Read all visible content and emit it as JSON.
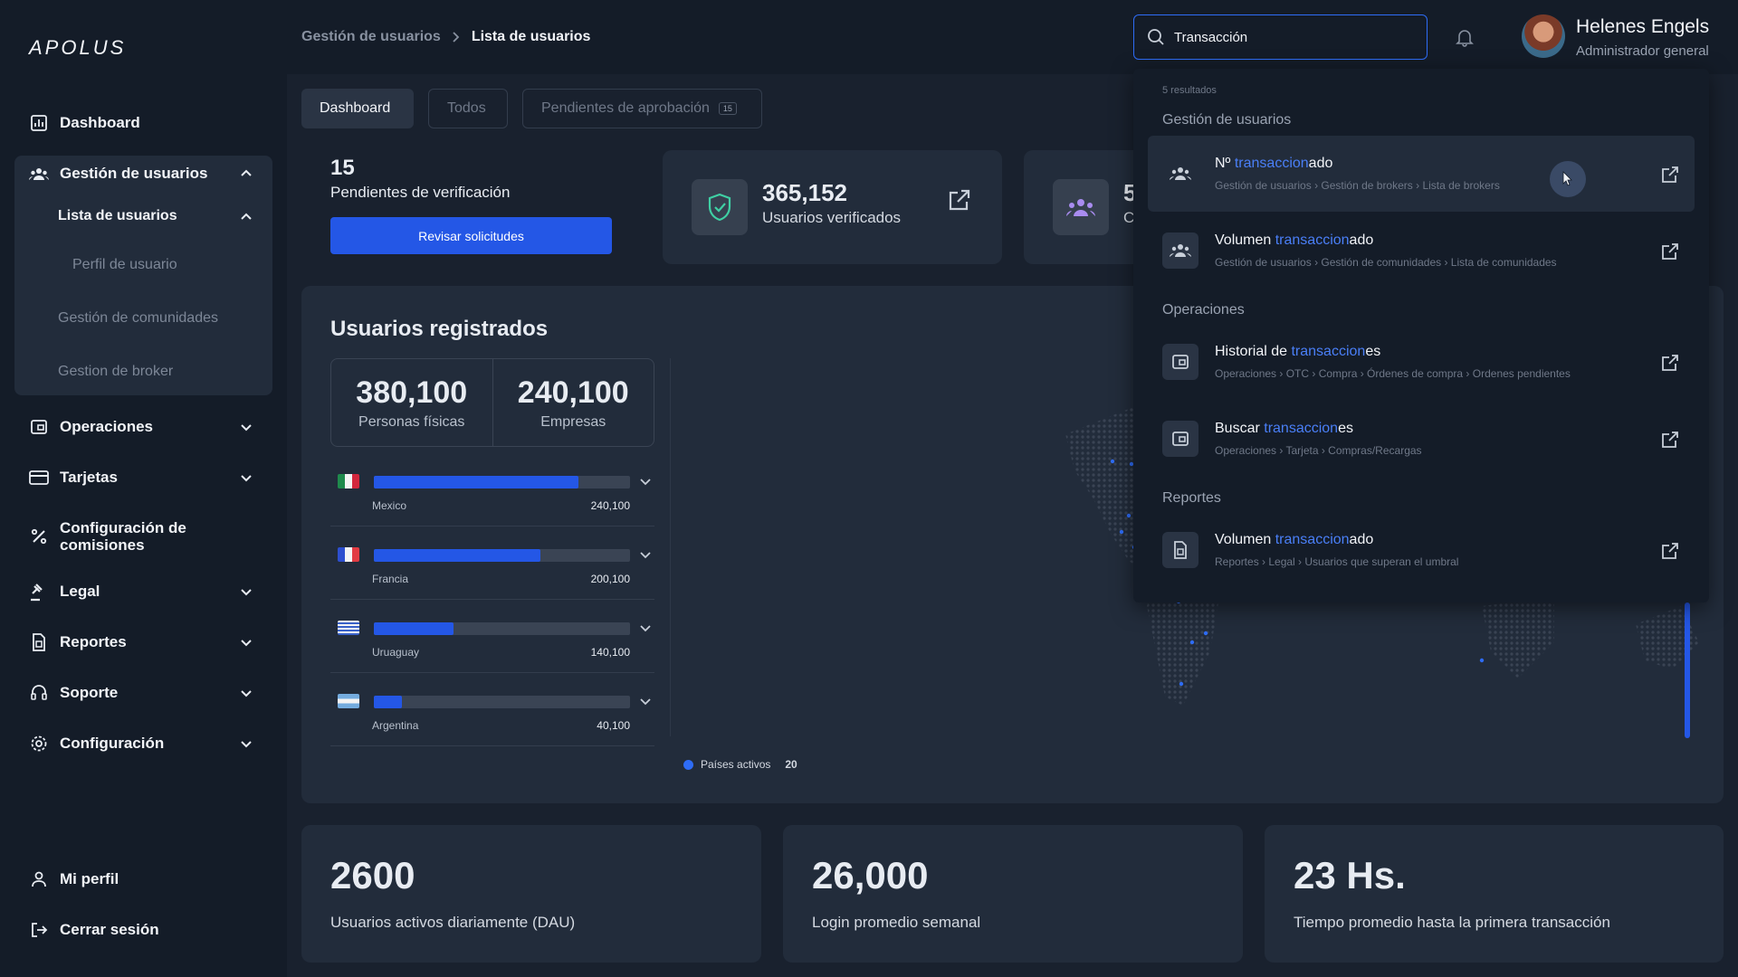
{
  "app": {
    "logo": "APOLUS"
  },
  "sidebar": {
    "items": [
      {
        "label": "Dashboard"
      },
      {
        "label": "Gestión de usuarios"
      },
      {
        "label": "Operaciones"
      },
      {
        "label": "Tarjetas"
      },
      {
        "label": "Configuración de comisiones"
      },
      {
        "label": "Legal"
      },
      {
        "label": "Reportes"
      },
      {
        "label": "Soporte"
      },
      {
        "label": "Configuración"
      }
    ],
    "sub": {
      "lista": "Lista de usuarios",
      "perfil": "Perfil de usuario",
      "comunidades": "Gestión de comunidades",
      "broker": "Gestion de broker"
    },
    "footer": {
      "perfil": "Mi perfil",
      "logout": "Cerrar sesión"
    }
  },
  "header": {
    "breadcrumb": [
      "Gestión de usuarios",
      "Lista de usuarios"
    ],
    "search_value": "Transacción",
    "user_name": "Helenes Engels",
    "user_role": "Administrador general"
  },
  "tabs": [
    {
      "label": "Dashboard"
    },
    {
      "label": "Todos"
    },
    {
      "label": "Pendientes de aprobación",
      "badge": "15"
    }
  ],
  "pending": {
    "count": "15",
    "label": "Pendientes de verificación",
    "button": "Revisar solicitudes"
  },
  "stats": [
    {
      "value": "365,152",
      "label": "Usuarios verificados"
    },
    {
      "value": "5",
      "label": "C"
    }
  ],
  "registered": {
    "title": "Usuarios registrados",
    "totals": [
      {
        "value": "380,100",
        "label": "Personas físicas"
      },
      {
        "value": "240,100",
        "label": "Empresas"
      }
    ],
    "countries": [
      {
        "name": "Mexico",
        "value": "240,100",
        "share": 0.8
      },
      {
        "name": "Francia",
        "value": "200,100",
        "share": 0.65
      },
      {
        "name": "Uruaguay",
        "value": "140,100",
        "share": 0.31
      },
      {
        "name": "Argentina",
        "value": "40,100",
        "share": 0.11
      }
    ],
    "legend": {
      "label": "Países activos",
      "value": "20"
    }
  },
  "kpis": [
    {
      "value": "2600",
      "label": "Usuarios activos diariamente (DAU)"
    },
    {
      "value": "26,000",
      "label": "Login promedio semanal"
    },
    {
      "value": "23 Hs.",
      "label": "Tiempo promedio hasta la primera transacción"
    }
  ],
  "search_results": {
    "count": "5 resultados",
    "sections": [
      "Gestión de usuarios",
      "Operaciones",
      "Reportes"
    ],
    "items": [
      {
        "pre": "Nº ",
        "hl": "transaccion",
        "post": "ado",
        "path": "Gestión de usuarios  ›  Gestión de brokers  ›  Lista de brokers"
      },
      {
        "pre": "Volumen ",
        "hl": "transaccion",
        "post": "ado",
        "path": "Gestión de usuarios  ›  Gestión de comunidades  ›  Lista de comunidades"
      },
      {
        "pre": "Historial de ",
        "hl": "transaccion",
        "post": "es",
        "path": "Operaciones  ›  OTC  ›  Compra  ›  Órdenes de compra  ›  Ordenes pendientes"
      },
      {
        "pre": "Buscar ",
        "hl": "transaccion",
        "post": "es",
        "path": "Operaciones  ›  Tarjeta  ›  Compras/Recargas"
      },
      {
        "pre": "Volumen ",
        "hl": "transaccion",
        "post": "ado",
        "path": "Reportes  ›  Legal  ›  Usuarios que superan el umbral"
      }
    ]
  },
  "colors": {
    "accent": "#2457e6",
    "highlight": "#4a7ff7",
    "bg": "#19212e",
    "card": "#222c3b"
  }
}
